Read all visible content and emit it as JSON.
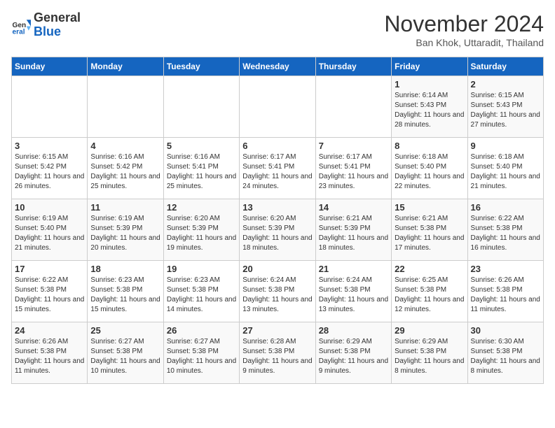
{
  "logo": {
    "general": "General",
    "blue": "Blue"
  },
  "title": "November 2024",
  "subtitle": "Ban Khok, Uttaradit, Thailand",
  "headers": [
    "Sunday",
    "Monday",
    "Tuesday",
    "Wednesday",
    "Thursday",
    "Friday",
    "Saturday"
  ],
  "weeks": [
    [
      {
        "day": "",
        "info": ""
      },
      {
        "day": "",
        "info": ""
      },
      {
        "day": "",
        "info": ""
      },
      {
        "day": "",
        "info": ""
      },
      {
        "day": "",
        "info": ""
      },
      {
        "day": "1",
        "info": "Sunrise: 6:14 AM\nSunset: 5:43 PM\nDaylight: 11 hours and 28 minutes."
      },
      {
        "day": "2",
        "info": "Sunrise: 6:15 AM\nSunset: 5:43 PM\nDaylight: 11 hours and 27 minutes."
      }
    ],
    [
      {
        "day": "3",
        "info": "Sunrise: 6:15 AM\nSunset: 5:42 PM\nDaylight: 11 hours and 26 minutes."
      },
      {
        "day": "4",
        "info": "Sunrise: 6:16 AM\nSunset: 5:42 PM\nDaylight: 11 hours and 25 minutes."
      },
      {
        "day": "5",
        "info": "Sunrise: 6:16 AM\nSunset: 5:41 PM\nDaylight: 11 hours and 25 minutes."
      },
      {
        "day": "6",
        "info": "Sunrise: 6:17 AM\nSunset: 5:41 PM\nDaylight: 11 hours and 24 minutes."
      },
      {
        "day": "7",
        "info": "Sunrise: 6:17 AM\nSunset: 5:41 PM\nDaylight: 11 hours and 23 minutes."
      },
      {
        "day": "8",
        "info": "Sunrise: 6:18 AM\nSunset: 5:40 PM\nDaylight: 11 hours and 22 minutes."
      },
      {
        "day": "9",
        "info": "Sunrise: 6:18 AM\nSunset: 5:40 PM\nDaylight: 11 hours and 21 minutes."
      }
    ],
    [
      {
        "day": "10",
        "info": "Sunrise: 6:19 AM\nSunset: 5:40 PM\nDaylight: 11 hours and 21 minutes."
      },
      {
        "day": "11",
        "info": "Sunrise: 6:19 AM\nSunset: 5:39 PM\nDaylight: 11 hours and 20 minutes."
      },
      {
        "day": "12",
        "info": "Sunrise: 6:20 AM\nSunset: 5:39 PM\nDaylight: 11 hours and 19 minutes."
      },
      {
        "day": "13",
        "info": "Sunrise: 6:20 AM\nSunset: 5:39 PM\nDaylight: 11 hours and 18 minutes."
      },
      {
        "day": "14",
        "info": "Sunrise: 6:21 AM\nSunset: 5:39 PM\nDaylight: 11 hours and 18 minutes."
      },
      {
        "day": "15",
        "info": "Sunrise: 6:21 AM\nSunset: 5:38 PM\nDaylight: 11 hours and 17 minutes."
      },
      {
        "day": "16",
        "info": "Sunrise: 6:22 AM\nSunset: 5:38 PM\nDaylight: 11 hours and 16 minutes."
      }
    ],
    [
      {
        "day": "17",
        "info": "Sunrise: 6:22 AM\nSunset: 5:38 PM\nDaylight: 11 hours and 15 minutes."
      },
      {
        "day": "18",
        "info": "Sunrise: 6:23 AM\nSunset: 5:38 PM\nDaylight: 11 hours and 15 minutes."
      },
      {
        "day": "19",
        "info": "Sunrise: 6:23 AM\nSunset: 5:38 PM\nDaylight: 11 hours and 14 minutes."
      },
      {
        "day": "20",
        "info": "Sunrise: 6:24 AM\nSunset: 5:38 PM\nDaylight: 11 hours and 13 minutes."
      },
      {
        "day": "21",
        "info": "Sunrise: 6:24 AM\nSunset: 5:38 PM\nDaylight: 11 hours and 13 minutes."
      },
      {
        "day": "22",
        "info": "Sunrise: 6:25 AM\nSunset: 5:38 PM\nDaylight: 11 hours and 12 minutes."
      },
      {
        "day": "23",
        "info": "Sunrise: 6:26 AM\nSunset: 5:38 PM\nDaylight: 11 hours and 11 minutes."
      }
    ],
    [
      {
        "day": "24",
        "info": "Sunrise: 6:26 AM\nSunset: 5:38 PM\nDaylight: 11 hours and 11 minutes."
      },
      {
        "day": "25",
        "info": "Sunrise: 6:27 AM\nSunset: 5:38 PM\nDaylight: 11 hours and 10 minutes."
      },
      {
        "day": "26",
        "info": "Sunrise: 6:27 AM\nSunset: 5:38 PM\nDaylight: 11 hours and 10 minutes."
      },
      {
        "day": "27",
        "info": "Sunrise: 6:28 AM\nSunset: 5:38 PM\nDaylight: 11 hours and 9 minutes."
      },
      {
        "day": "28",
        "info": "Sunrise: 6:29 AM\nSunset: 5:38 PM\nDaylight: 11 hours and 9 minutes."
      },
      {
        "day": "29",
        "info": "Sunrise: 6:29 AM\nSunset: 5:38 PM\nDaylight: 11 hours and 8 minutes."
      },
      {
        "day": "30",
        "info": "Sunrise: 6:30 AM\nSunset: 5:38 PM\nDaylight: 11 hours and 8 minutes."
      }
    ]
  ]
}
